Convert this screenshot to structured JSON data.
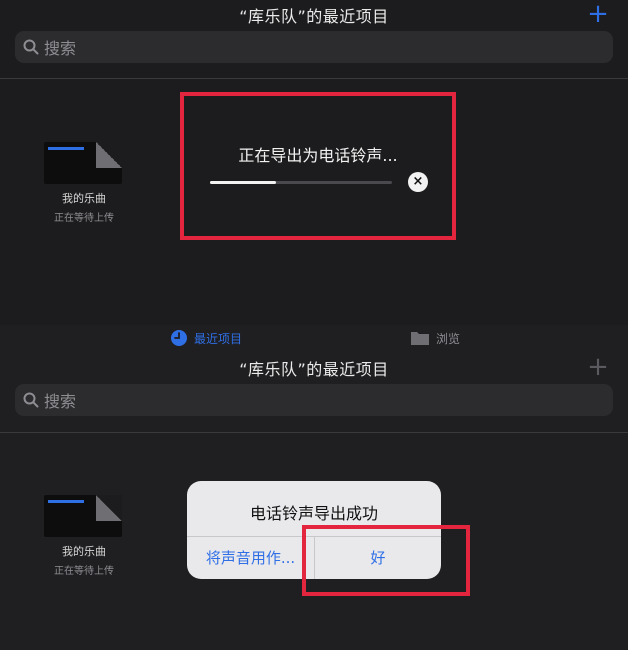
{
  "top_panel": {
    "title": "“库乐队”的最近项目",
    "add_label": "+",
    "search_placeholder": "搜索",
    "document": {
      "name": "我的乐曲",
      "status": "正在等待上传"
    },
    "export": {
      "title": "正在导出为电话铃声...",
      "progress": 0.36,
      "cancel_label": "×"
    }
  },
  "tab_bar": {
    "recent_label": "最近项目",
    "browse_label": "浏览"
  },
  "bottom_panel": {
    "title": "“库乐队”的最近项目",
    "add_label": "+",
    "search_placeholder": "搜索",
    "document": {
      "name": "我的乐曲",
      "status": "正在等待上传"
    },
    "alert": {
      "title": "电话铃声导出成功",
      "use_sound_label": "将声音用作...",
      "ok_label": "好"
    }
  },
  "colors": {
    "accent": "#2f6fe6",
    "highlight": "#e3253d",
    "background": "#1c1c1e"
  }
}
